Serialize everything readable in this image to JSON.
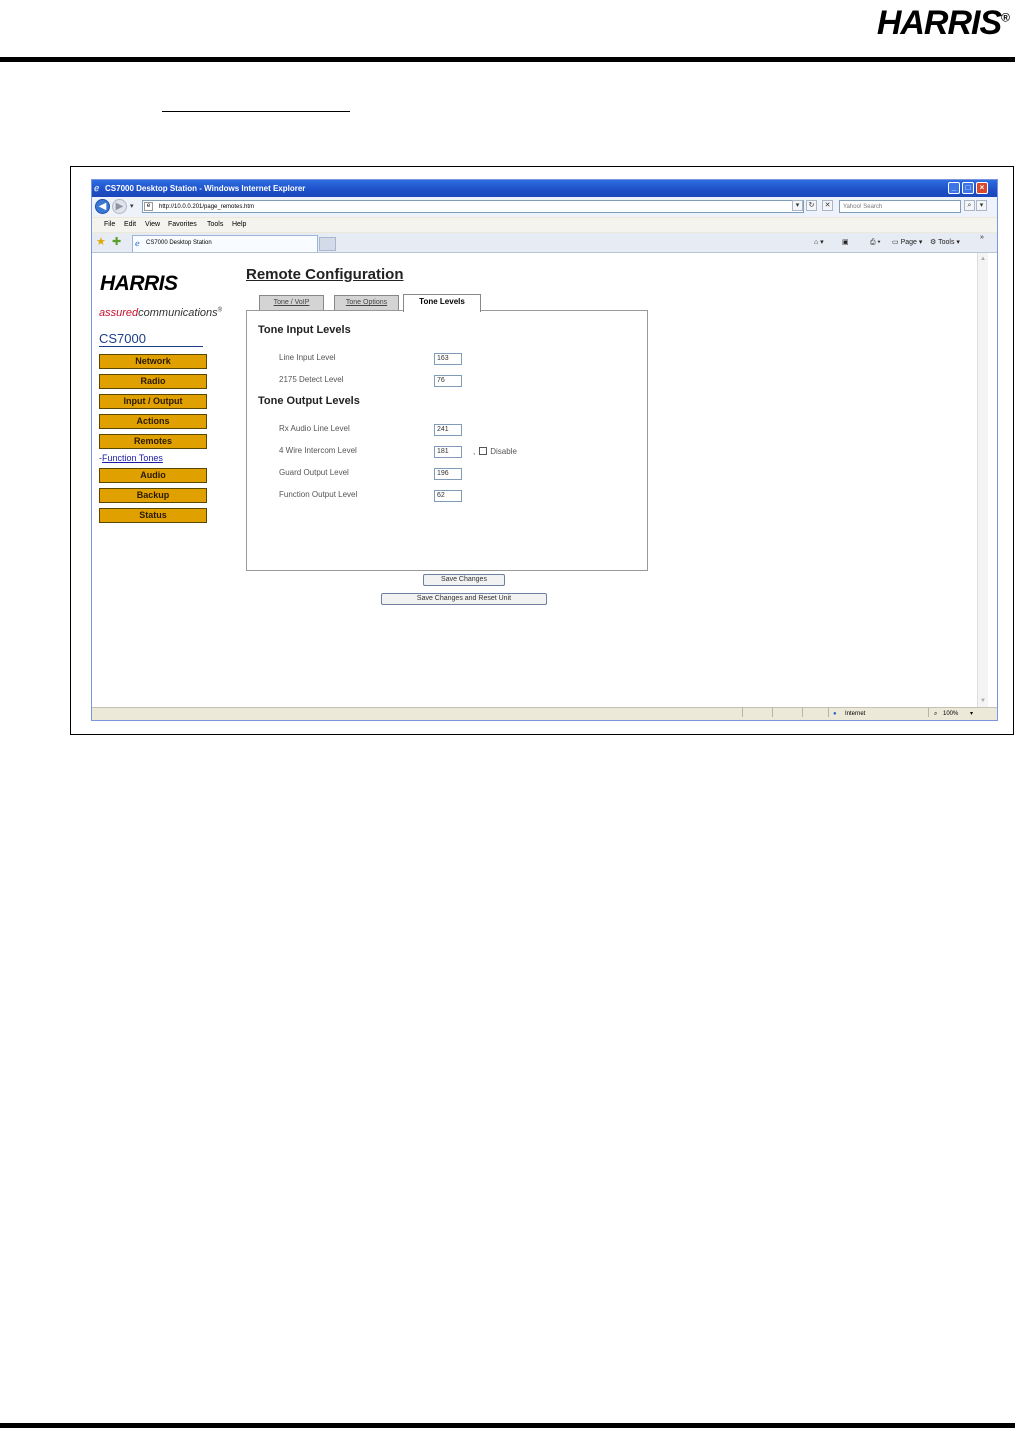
{
  "doc": {
    "logo_text": "HARRIS",
    "logo_reg": "®"
  },
  "browser": {
    "title": "CS7000 Desktop Station - Windows Internet Explorer",
    "address": "http://10.0.0.201/page_remotes.htm",
    "search_placeholder": "Yahoo! Search",
    "menu": [
      "File",
      "Edit",
      "View",
      "Favorites",
      "Tools",
      "Help"
    ],
    "tab_label": "CS7000 Desktop Station",
    "commands": [
      "Page",
      "Tools"
    ],
    "status_zone": "Internet",
    "zoom": "100%"
  },
  "page": {
    "logo_text": "HARRIS",
    "tagline_red": "assured",
    "tagline_rest": "communications",
    "tagline_mark": "®",
    "product": "CS7000",
    "title": "Remote Configuration",
    "nav": [
      {
        "label": "Network"
      },
      {
        "label": "Radio"
      },
      {
        "label": "Input / Output"
      },
      {
        "label": "Actions"
      },
      {
        "label": "Remotes"
      },
      {
        "label": "Audio"
      },
      {
        "label": "Backup"
      },
      {
        "label": "Status"
      }
    ],
    "sub_nav": {
      "prefix": "-",
      "label": "Function Tones"
    },
    "tabs": [
      "Tone / VoIP",
      "Tone Options",
      "Tone Levels"
    ],
    "active_tab": "Tone Levels",
    "sections": {
      "input": {
        "title": "Tone Input Levels",
        "fields": [
          {
            "label": "Line Input Level",
            "value": "163"
          },
          {
            "label": "2175 Detect Level",
            "value": "76"
          }
        ]
      },
      "output": {
        "title": "Tone Output Levels",
        "fields": [
          {
            "label": "Rx Audio Line Level",
            "value": "241"
          },
          {
            "label": "4 Wire Intercom Level",
            "value": "181"
          },
          {
            "label": "Guard Output Level",
            "value": "196"
          },
          {
            "label": "Function Output Level",
            "value": "62"
          }
        ],
        "disable_label": "Disable",
        "separator": ","
      }
    },
    "buttons": {
      "save": "Save Changes",
      "save_reset": "Save Changes and Reset Unit"
    }
  }
}
